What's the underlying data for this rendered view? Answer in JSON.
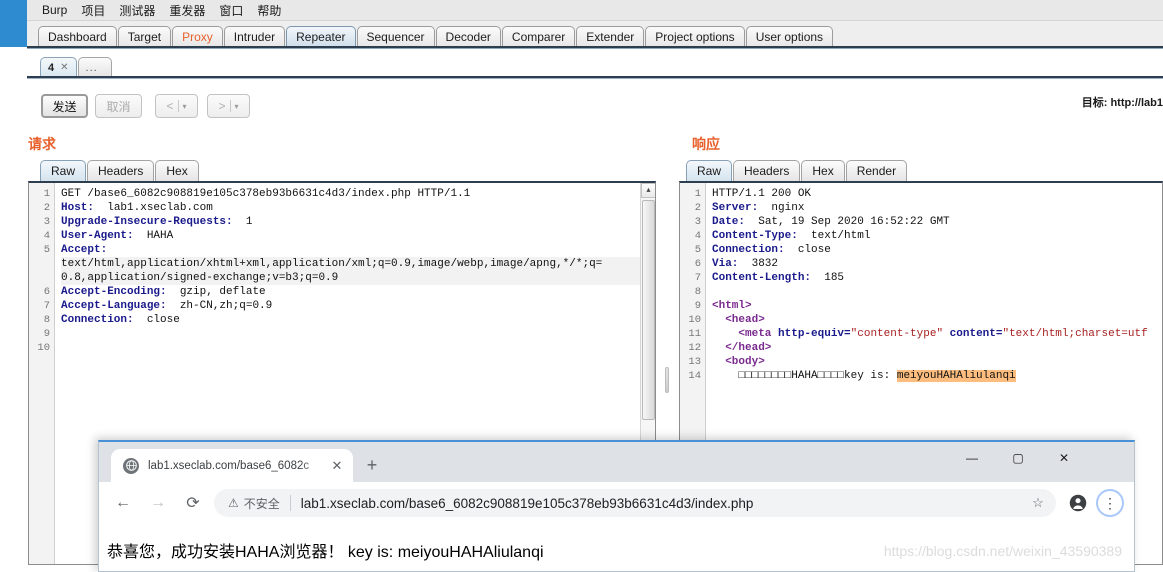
{
  "burp": {
    "menu": [
      "Burp",
      "项目",
      "测试器",
      "重发器",
      "窗口",
      "帮助"
    ],
    "main_tabs": [
      {
        "label": "Dashboard",
        "active": false,
        "accent": false
      },
      {
        "label": "Target",
        "active": false,
        "accent": false
      },
      {
        "label": "Proxy",
        "active": false,
        "accent": true
      },
      {
        "label": "Intruder",
        "active": false,
        "accent": false
      },
      {
        "label": "Repeater",
        "active": true,
        "accent": false
      },
      {
        "label": "Sequencer",
        "active": false,
        "accent": false
      },
      {
        "label": "Decoder",
        "active": false,
        "accent": false
      },
      {
        "label": "Comparer",
        "active": false,
        "accent": false
      },
      {
        "label": "Extender",
        "active": false,
        "accent": false
      },
      {
        "label": "Project options",
        "active": false,
        "accent": false
      },
      {
        "label": "User options",
        "active": false,
        "accent": false
      }
    ],
    "repeater_tabs": {
      "current": "4",
      "close_glyph": "✕",
      "add_label": "..."
    },
    "actions": {
      "send": "发送",
      "cancel": "取消",
      "prev": "<",
      "next": ">",
      "caret": "▾"
    },
    "target": "目标: http://lab1",
    "request": {
      "title": "请求",
      "tabs": [
        "Raw",
        "Headers",
        "Hex"
      ],
      "active_tab": "Raw",
      "lines": [
        {
          "n": "1",
          "segments": [
            {
              "t": "GET /base6_6082c908819e105c378eb93b6631c4d3/index.php HTTP/1.1",
              "c": "k-val"
            }
          ]
        },
        {
          "n": "2",
          "segments": [
            {
              "t": "Host:",
              "c": "k-hdr"
            },
            {
              "t": "  lab1.xseclab.com",
              "c": "k-val"
            }
          ]
        },
        {
          "n": "3",
          "segments": [
            {
              "t": "Upgrade-Insecure-Requests:",
              "c": "k-hdr"
            },
            {
              "t": "  1",
              "c": "k-val"
            }
          ]
        },
        {
          "n": "4",
          "segments": [
            {
              "t": "User-Agent:",
              "c": "k-hdr"
            },
            {
              "t": "  HAHA",
              "c": "k-val"
            }
          ]
        },
        {
          "n": "5",
          "segments": [
            {
              "t": "Accept:",
              "c": "k-hdr"
            }
          ]
        },
        {
          "n": "",
          "wrapped": true,
          "segments": [
            {
              "t": "text/html,application/xhtml+xml,application/xml;q=0.9,image/webp,image/apng,*/*;q=",
              "c": "k-val"
            }
          ]
        },
        {
          "n": "",
          "wrapped": true,
          "segments": [
            {
              "t": "0.8,application/signed-exchange;v=b3;q=0.9",
              "c": "k-val"
            }
          ]
        },
        {
          "n": "6",
          "segments": [
            {
              "t": "Accept-Encoding:",
              "c": "k-hdr"
            },
            {
              "t": "  gzip, deflate",
              "c": "k-val"
            }
          ]
        },
        {
          "n": "7",
          "segments": [
            {
              "t": "Accept-Language:",
              "c": "k-hdr"
            },
            {
              "t": "  zh-CN,zh;q=0.9",
              "c": "k-val"
            }
          ]
        },
        {
          "n": "8",
          "segments": [
            {
              "t": "Connection:",
              "c": "k-hdr"
            },
            {
              "t": "  close",
              "c": "k-val"
            }
          ]
        },
        {
          "n": "9",
          "segments": []
        },
        {
          "n": "10",
          "segments": []
        }
      ]
    },
    "response": {
      "title": "响应",
      "tabs": [
        "Raw",
        "Headers",
        "Hex",
        "Render"
      ],
      "active_tab": "Raw",
      "lines": [
        {
          "n": "1",
          "segments": [
            {
              "t": "HTTP/1.1 200 OK",
              "c": "k-val"
            }
          ]
        },
        {
          "n": "2",
          "segments": [
            {
              "t": "Server:",
              "c": "k-hdr"
            },
            {
              "t": "  nginx",
              "c": "k-val"
            }
          ]
        },
        {
          "n": "3",
          "segments": [
            {
              "t": "Date:",
              "c": "k-hdr"
            },
            {
              "t": "  Sat, 19 Sep 2020 16:52:22 GMT",
              "c": "k-val"
            }
          ]
        },
        {
          "n": "4",
          "segments": [
            {
              "t": "Content-Type:",
              "c": "k-hdr"
            },
            {
              "t": "  text/html",
              "c": "k-val"
            }
          ]
        },
        {
          "n": "5",
          "segments": [
            {
              "t": "Connection:",
              "c": "k-hdr"
            },
            {
              "t": "  close",
              "c": "k-val"
            }
          ]
        },
        {
          "n": "6",
          "segments": [
            {
              "t": "Via:",
              "c": "k-hdr"
            },
            {
              "t": "  3832",
              "c": "k-val"
            }
          ]
        },
        {
          "n": "7",
          "segments": [
            {
              "t": "Content-Length:",
              "c": "k-hdr"
            },
            {
              "t": "  185",
              "c": "k-val"
            }
          ]
        },
        {
          "n": "8",
          "segments": []
        },
        {
          "n": "9",
          "segments": [
            {
              "t": "<html>",
              "c": "k-tag"
            }
          ]
        },
        {
          "n": "10",
          "segments": [
            {
              "t": "  <head>",
              "c": "k-tag"
            }
          ]
        },
        {
          "n": "11",
          "segments": [
            {
              "t": "    <meta ",
              "c": "k-tag"
            },
            {
              "t": "http-equiv=",
              "c": "k-attr"
            },
            {
              "t": "\"content-type\"",
              "c": "k-str"
            },
            {
              "t": " content=",
              "c": "k-attr"
            },
            {
              "t": "\"text/html;charset=utf",
              "c": "k-str"
            }
          ]
        },
        {
          "n": "12",
          "segments": [
            {
              "t": "  </head>",
              "c": "k-tag"
            }
          ]
        },
        {
          "n": "13",
          "segments": [
            {
              "t": "  <body>",
              "c": "k-tag"
            }
          ]
        },
        {
          "n": "14",
          "segments": [
            {
              "t": "    □□□□□□□□HAHA□□□□key is: ",
              "c": "k-txt"
            },
            {
              "t": "meiyouHAHAliulanqi",
              "c": "hl"
            }
          ]
        }
      ]
    }
  },
  "browser": {
    "tab": {
      "favicon": "globe-icon",
      "title": "lab1.xseclab.com/base6_6082c",
      "close": "✕",
      "newtab": "+"
    },
    "window_controls": {
      "minimize": "—",
      "maximize": "▢",
      "close": "✕"
    },
    "toolbar": {
      "back": "←",
      "forward": "→",
      "reload": "⟳",
      "warn_icon": "⚠",
      "warn_label": "不安全",
      "url": "lab1.xseclab.com/base6_6082c908819e105c378eb93b6631c4d3/index.php",
      "star": "☆",
      "profile": "person-icon",
      "menu": "⋮"
    },
    "page": {
      "text": "恭喜您，成功安装HAHA浏览器！ key is: meiyouHAHAliulanqi",
      "watermark": "https://blog.csdn.net/weixin_43590389"
    }
  }
}
